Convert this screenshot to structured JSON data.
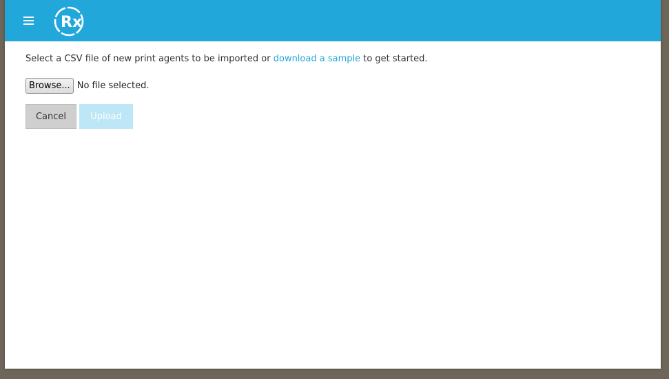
{
  "colors": {
    "header_bg": "#22a7da",
    "link": "#22a7da",
    "upload_disabled_bg": "#bde6f6",
    "cancel_bg": "#cfcfcf"
  },
  "header": {
    "menu_icon": "hamburger-menu-icon",
    "logo_icon": "rx-logo-icon",
    "logo_text": "Rx"
  },
  "import": {
    "intro_before": "Select a CSV file of new print agents to be imported or ",
    "sample_link": "download a sample",
    "intro_after": " to get started.",
    "browse_label": "Browse...",
    "file_status": "No file selected."
  },
  "actions": {
    "cancel_label": "Cancel",
    "upload_label": "Upload",
    "upload_disabled": true
  }
}
